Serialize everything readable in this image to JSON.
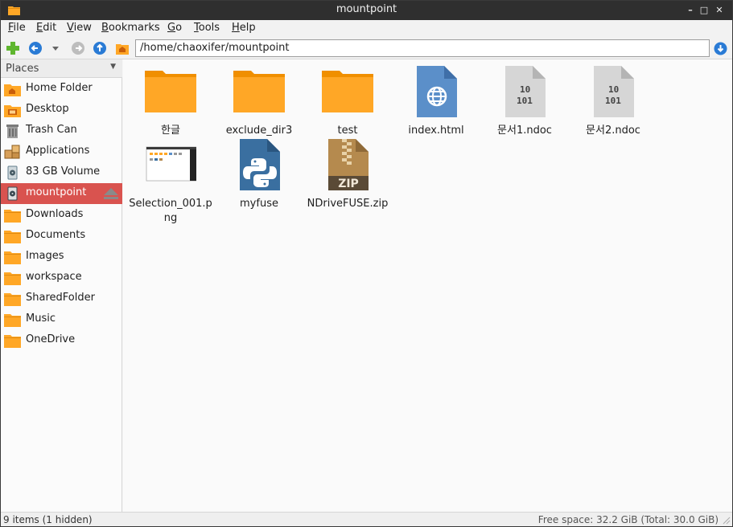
{
  "window": {
    "title": "mountpoint"
  },
  "menubar": [
    {
      "label": "File",
      "mnemonic": "F"
    },
    {
      "label": "Edit",
      "mnemonic": "E"
    },
    {
      "label": "View",
      "mnemonic": "V"
    },
    {
      "label": "Bookmarks",
      "mnemonic": "B"
    },
    {
      "label": "Go",
      "mnemonic": "G"
    },
    {
      "label": "Tools",
      "mnemonic": "T"
    },
    {
      "label": "Help",
      "mnemonic": "H"
    }
  ],
  "toolbar": {
    "path": "/home/chaoxifer/mountpoint"
  },
  "sidebar": {
    "header": "Places",
    "items": [
      {
        "label": "Home Folder",
        "icon": "home-folder-icon"
      },
      {
        "label": "Desktop",
        "icon": "desktop-icon"
      },
      {
        "label": "Trash Can",
        "icon": "trash-icon"
      },
      {
        "label": "Applications",
        "icon": "applications-icon"
      },
      {
        "label": "83 GB Volume",
        "icon": "drive-icon"
      },
      {
        "label": "mountpoint",
        "icon": "mounted-drive-icon",
        "active": true
      },
      {
        "label": "Downloads",
        "icon": "folder-icon"
      },
      {
        "label": "Documents",
        "icon": "folder-icon"
      },
      {
        "label": "Images",
        "icon": "folder-icon"
      },
      {
        "label": "workspace",
        "icon": "folder-icon"
      },
      {
        "label": "SharedFolder",
        "icon": "folder-icon"
      },
      {
        "label": "Music",
        "icon": "folder-icon"
      },
      {
        "label": "OneDrive",
        "icon": "folder-icon"
      }
    ]
  },
  "files": [
    {
      "name": "한글",
      "type": "folder"
    },
    {
      "name": "exclude_dir3",
      "type": "folder"
    },
    {
      "name": "test",
      "type": "folder"
    },
    {
      "name": "index.html",
      "type": "html"
    },
    {
      "name": "문서1.ndoc",
      "type": "binary"
    },
    {
      "name": "문서2.ndoc",
      "type": "binary"
    },
    {
      "name": "Selection_001.png",
      "type": "image"
    },
    {
      "name": "myfuse",
      "type": "python"
    },
    {
      "name": "NDriveFUSE.zip",
      "type": "zip"
    }
  ],
  "zip_label": "ZIP",
  "binary_label": {
    "line1": "10",
    "line2": "101"
  },
  "status": {
    "items": "9 items (1 hidden)",
    "free_space": "Free space: 32.2 GiB (Total: 30.0 GiB)"
  },
  "colors": {
    "folder": "#ffa726",
    "active": "#d9534f",
    "html_icon": "#5b8fc9",
    "python_icon": "#3a6fa0",
    "zip_icon": "#b58a4e"
  }
}
